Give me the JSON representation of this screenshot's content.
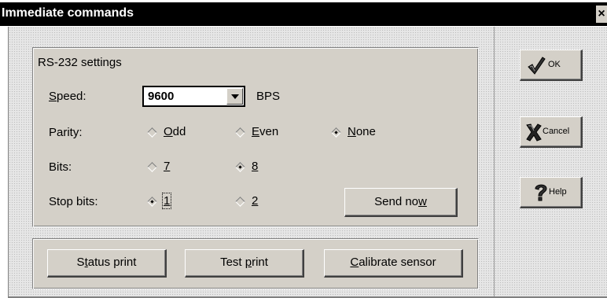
{
  "window": {
    "title": "Immediate commands",
    "close_glyph": "×"
  },
  "rs232": {
    "group_title": "RS-232 settings",
    "speed": {
      "label_key": "S",
      "label_rest": "peed:",
      "value": "9600",
      "unit": "BPS"
    },
    "parity": {
      "label": "Parity:",
      "options": [
        {
          "key": "O",
          "rest": "dd",
          "selected": false
        },
        {
          "key": "E",
          "rest": "ven",
          "selected": false
        },
        {
          "key": "N",
          "rest": "one",
          "selected": true
        }
      ]
    },
    "bits": {
      "label": "Bits:",
      "options": [
        {
          "key": "7",
          "rest": "",
          "selected": false
        },
        {
          "key": "8",
          "rest": "",
          "selected": true
        }
      ]
    },
    "stop_bits": {
      "label": "Stop bits:",
      "options": [
        {
          "key": "1",
          "rest": "",
          "selected": true,
          "focused": true
        },
        {
          "key": "2",
          "rest": "",
          "selected": false
        }
      ]
    },
    "send_now": {
      "pre": "Send no",
      "key": "w",
      "post": ""
    }
  },
  "actions": {
    "status_print": {
      "pre": "S",
      "key": "t",
      "post": "atus print"
    },
    "test_print": {
      "pre": "Test ",
      "key": "p",
      "post": "rint"
    },
    "calibrate": {
      "pre": "",
      "key": "C",
      "post": "alibrate sensor"
    }
  },
  "side_buttons": {
    "ok": {
      "label": "OK",
      "icon": "checkmark-icon"
    },
    "cancel": {
      "label": "Cancel",
      "icon": "x-icon"
    },
    "help": {
      "label": "Help",
      "icon": "question-mark-icon"
    }
  }
}
